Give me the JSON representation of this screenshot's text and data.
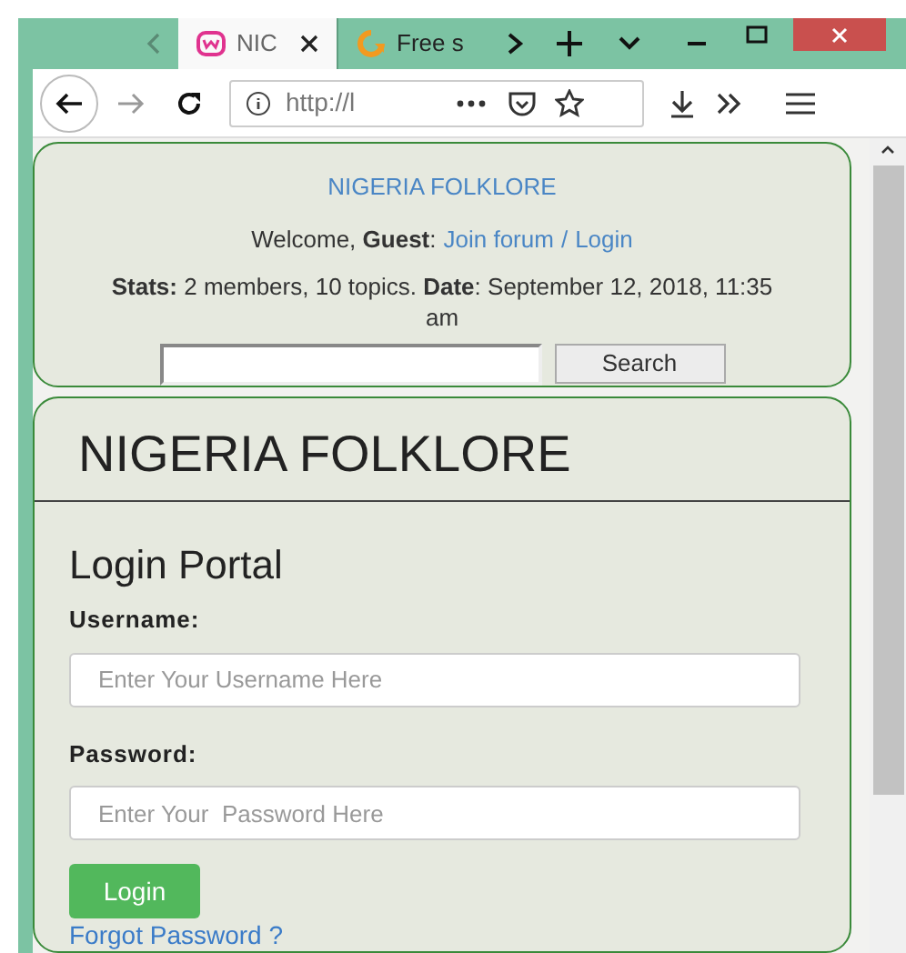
{
  "browser": {
    "tabs": [
      {
        "title": "NIC",
        "selected": true,
        "kind": "site"
      },
      {
        "title": "Free s",
        "selected": false,
        "kind": "download"
      }
    ],
    "url": "http://l"
  },
  "forum_header": {
    "title": "NIGERIA FOLKLORE",
    "welcome": "Welcome, **Guest**: ",
    "links": [
      "Join forum",
      "Login"
    ],
    "separator": "/",
    "stats": "**Stats:** 2 members, 10 topics. **Date**: September 12, 2018, 11:35 am",
    "search_button": "Search"
  },
  "login_panel": {
    "site_title": "NIGERIA FOLKLORE",
    "heading": "Login Portal",
    "fields": [
      {
        "label": "Username:",
        "placeholder": "Enter Your Username Here"
      },
      {
        "label": "Password:",
        "placeholder": "Enter Your  Password Here"
      }
    ],
    "submit": "Login",
    "forgot_link": "Forgot Password ?"
  }
}
